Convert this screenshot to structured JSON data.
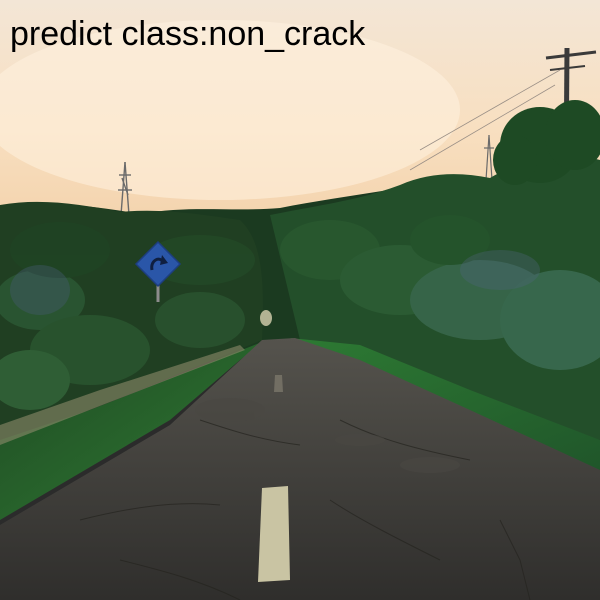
{
  "caption": {
    "text": "predict class:non_crack"
  },
  "scene": {
    "description_tags": [
      "road-photo"
    ],
    "colors": {
      "sky_top": "#f4e4cf",
      "sky_bottom": "#f7d9b6",
      "hill_dark": "#17331d",
      "hill_mid": "#25512b",
      "grass": "#2f7a35",
      "road": "#3d3c39",
      "road_line": "#c9c4a3",
      "sign": "#2a56a8"
    }
  }
}
